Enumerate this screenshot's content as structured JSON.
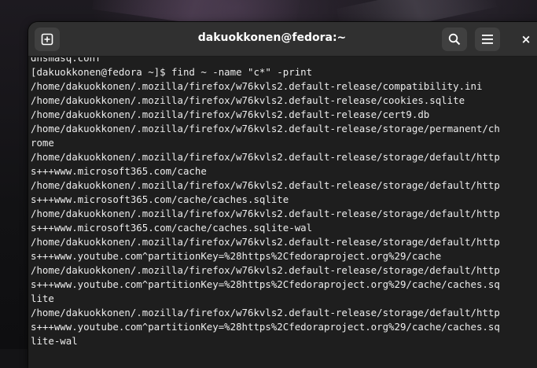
{
  "window": {
    "title": "dakuokkonen@fedora:~",
    "buttons": {
      "new_tab_icon": "new-tab-icon",
      "search_icon": "search-icon",
      "menu_icon": "hamburger-menu-icon",
      "close_label": "×"
    }
  },
  "terminal": {
    "lines": [
      "dnsmasq.conf",
      "[dakuokkonen@fedora ~]$ find ~ -name \"c*\" -print",
      "/home/dakuokkonen/.mozilla/firefox/w76kvls2.default-release/compatibility.ini",
      "/home/dakuokkonen/.mozilla/firefox/w76kvls2.default-release/cookies.sqlite",
      "/home/dakuokkonen/.mozilla/firefox/w76kvls2.default-release/cert9.db",
      "/home/dakuokkonen/.mozilla/firefox/w76kvls2.default-release/storage/permanent/ch",
      "rome",
      "/home/dakuokkonen/.mozilla/firefox/w76kvls2.default-release/storage/default/http",
      "s+++www.microsoft365.com/cache",
      "/home/dakuokkonen/.mozilla/firefox/w76kvls2.default-release/storage/default/http",
      "s+++www.microsoft365.com/cache/caches.sqlite",
      "/home/dakuokkonen/.mozilla/firefox/w76kvls2.default-release/storage/default/http",
      "s+++www.microsoft365.com/cache/caches.sqlite-wal",
      "/home/dakuokkonen/.mozilla/firefox/w76kvls2.default-release/storage/default/http",
      "s+++www.youtube.com^partitionKey=%28https%2Cfedoraproject.org%29/cache",
      "/home/dakuokkonen/.mozilla/firefox/w76kvls2.default-release/storage/default/http",
      "s+++www.youtube.com^partitionKey=%28https%2Cfedoraproject.org%29/cache/caches.sq",
      "lite",
      "/home/dakuokkonen/.mozilla/firefox/w76kvls2.default-release/storage/default/http",
      "s+++www.youtube.com^partitionKey=%28https%2Cfedoraproject.org%29/cache/caches.sq",
      "lite-wal"
    ]
  }
}
